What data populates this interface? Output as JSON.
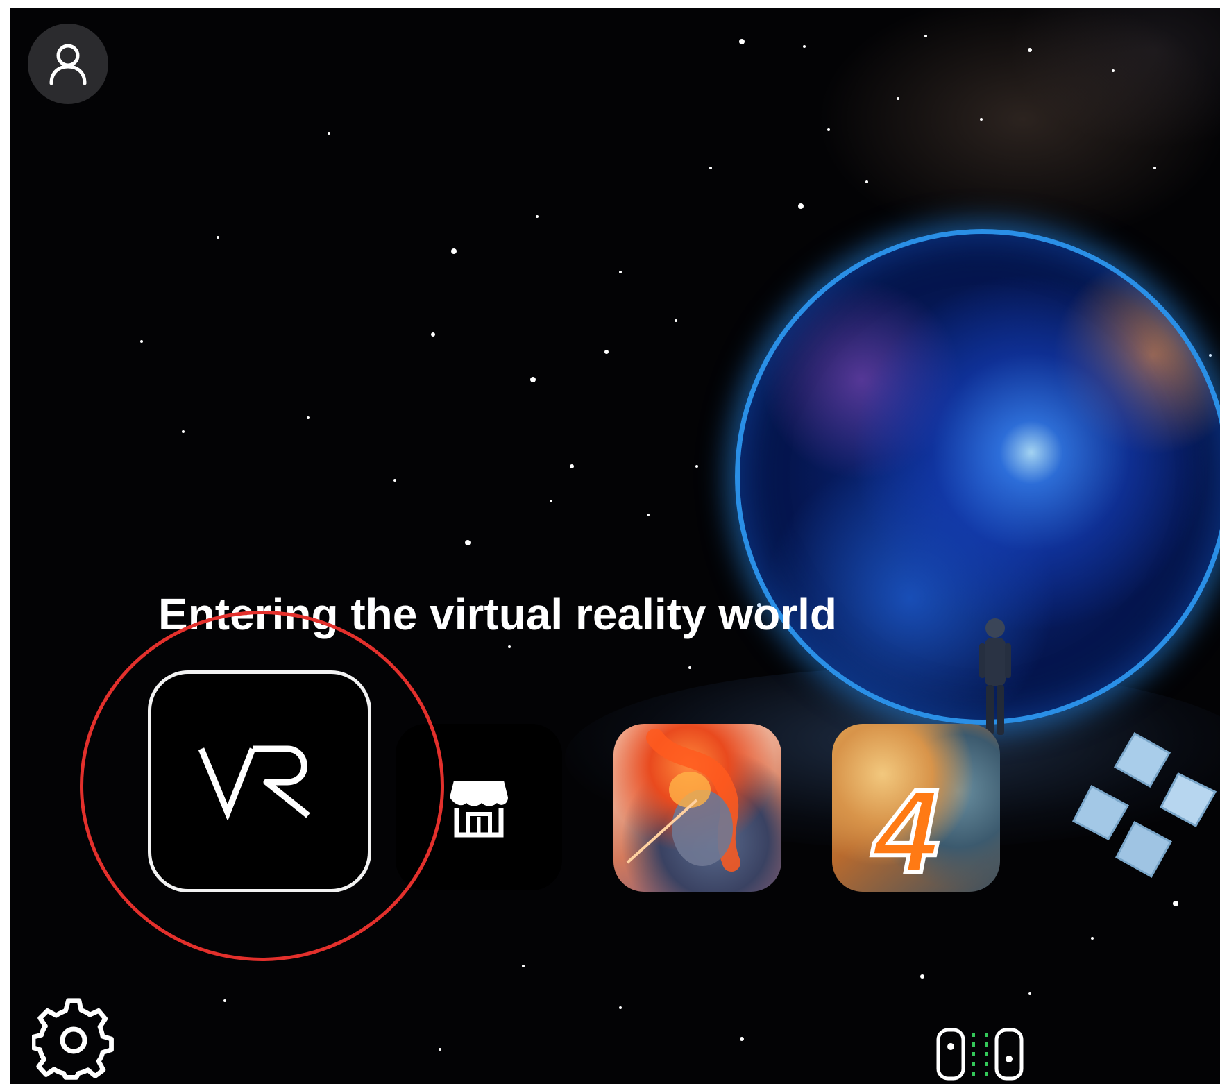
{
  "screen": {
    "heading": "Entering the virtual reality world"
  },
  "header": {
    "profile_icon": "user-profile-icon"
  },
  "apps": [
    {
      "id": "vr",
      "icon": "vr-logo-icon",
      "label": "VR",
      "selected": true
    },
    {
      "id": "store",
      "icon": "store-icon"
    },
    {
      "id": "game-1",
      "icon": "game-cover-fire-warrior"
    },
    {
      "id": "game-2",
      "icon": "game-cover-anime-4",
      "label": "4"
    },
    {
      "id": "ppsspp",
      "icon": "ppsspp-emulator-icon"
    }
  ],
  "footer": {
    "settings_icon": "gear-icon",
    "controllers_icon": "joy-con-controllers-icon"
  },
  "colors": {
    "background": "#030305",
    "portal_ring": "#2a8fe6",
    "annotation": "#e3302c",
    "profile_button": "#2b2b2e"
  }
}
